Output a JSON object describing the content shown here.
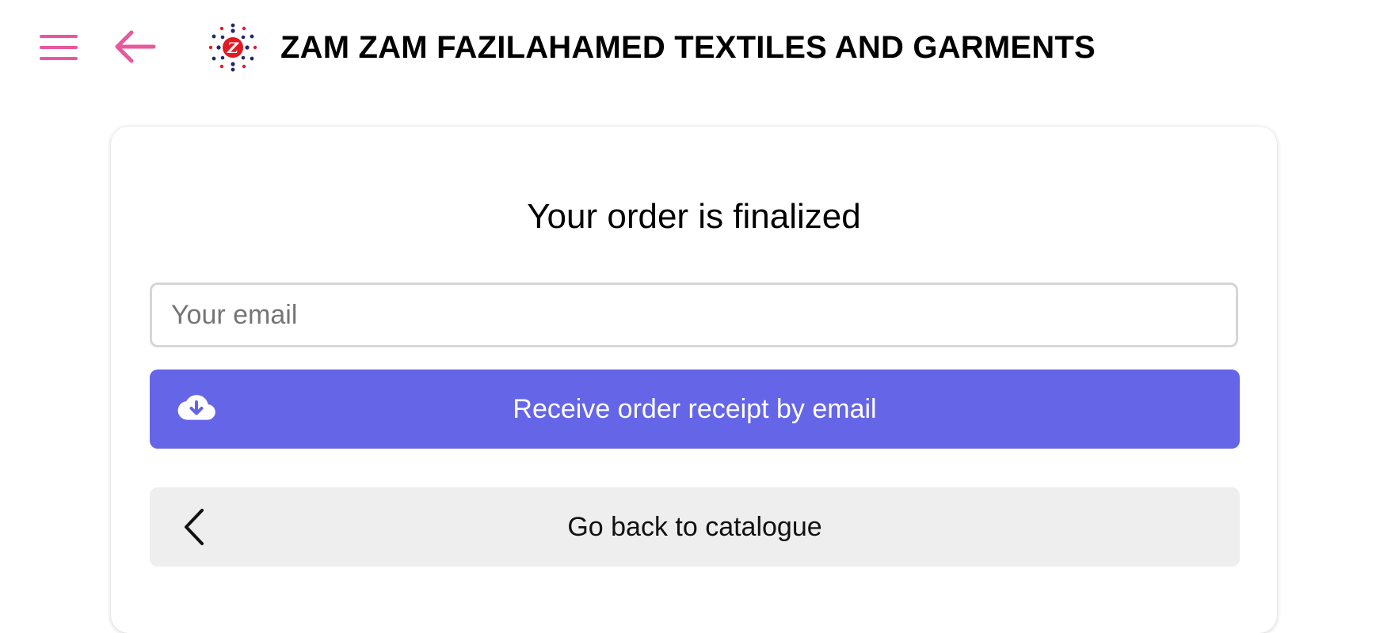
{
  "header": {
    "store_name": "ZAM ZAM FAZILAHAMED TEXTILES AND GARMENTS",
    "menu_icon": "hamburger-menu-icon",
    "back_icon": "arrow-left-icon",
    "logo_letter": "Z"
  },
  "order": {
    "title": "Your order is finalized",
    "email_placeholder": "Your email",
    "email_value": "",
    "receipt_button_label": "Receive order receipt by email",
    "receipt_button_icon": "cloud-download-icon",
    "back_button_label": "Go back to catalogue",
    "back_button_icon": "chevron-left-icon"
  },
  "colors": {
    "accent_pink": "#e8589c",
    "primary_button": "#6565e8",
    "secondary_button": "#eeeeee",
    "logo_red": "#e01b24",
    "logo_navy": "#1f2a6b"
  }
}
